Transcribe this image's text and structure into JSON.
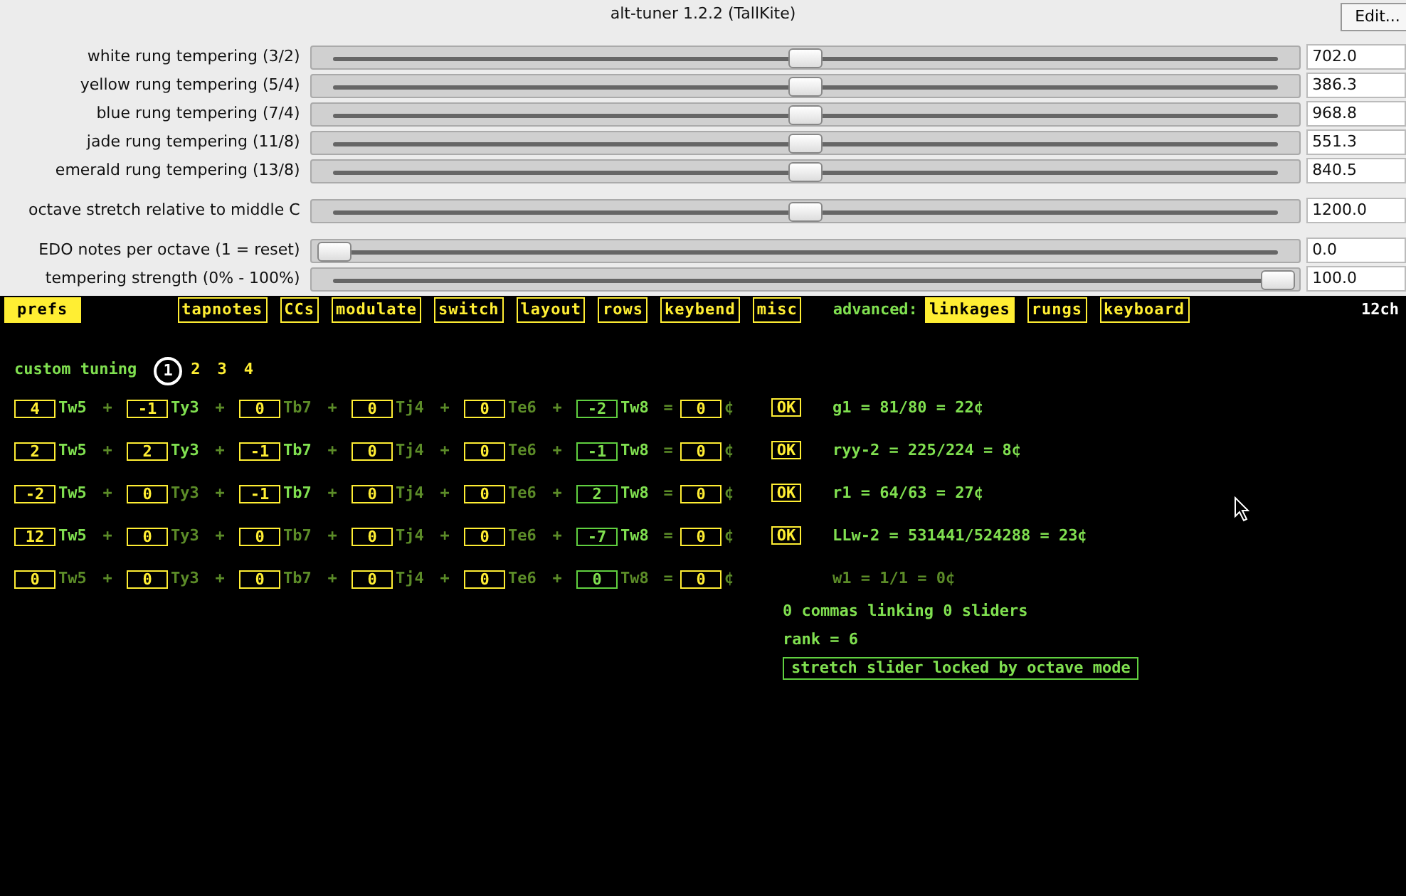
{
  "window": {
    "title": "alt-tuner 1.2.2 (TallKite)",
    "edit_button": "Edit..."
  },
  "slider_groups": [
    [
      {
        "label": "white rung tempering (3/2)",
        "level": 0.5,
        "reading": "702.0"
      },
      {
        "label": "yellow rung tempering (5/4)",
        "level": 0.5,
        "reading": "386.3"
      },
      {
        "label": "blue rung tempering (7/4)",
        "level": 0.5,
        "reading": "968.8"
      },
      {
        "label": "jade rung tempering (11/8)",
        "level": 0.5,
        "reading": "551.3"
      },
      {
        "label": "emerald rung tempering (13/8)",
        "level": 0.5,
        "reading": "840.5"
      }
    ],
    [
      {
        "label": "octave stretch relative to middle C",
        "level": 0.5,
        "reading": "1200.0"
      }
    ],
    [
      {
        "label": "EDO notes per octave (1 = reset)",
        "level": 0,
        "reading": "0.0"
      },
      {
        "label": "tempering strength (0% - 100%)",
        "level": 1,
        "reading": "100.0"
      }
    ]
  ],
  "tabs": [
    {
      "label": "prefs",
      "selected": true
    },
    {
      "label": "tapnotes",
      "selected": false
    },
    {
      "label": "CCs",
      "selected": false
    },
    {
      "label": "modulate",
      "selected": false
    },
    {
      "label": "switch",
      "selected": false
    },
    {
      "label": "layout",
      "selected": false
    },
    {
      "label": "rows",
      "selected": false
    },
    {
      "label": "keybend",
      "selected": false
    },
    {
      "label": "misc",
      "selected": false
    }
  ],
  "advanced_label": "advanced:",
  "advanced_tabs": [
    {
      "label": "linkages",
      "selected": true
    },
    {
      "label": "rungs",
      "selected": false
    },
    {
      "label": "keyboard",
      "selected": false
    }
  ],
  "channels": "12ch",
  "tuning": {
    "label": "custom tuning",
    "options": [
      {
        "label": "1",
        "selected": true
      },
      {
        "label": "2",
        "selected": false
      },
      {
        "label": "3",
        "selected": false
      },
      {
        "label": "4",
        "selected": false
      }
    ]
  },
  "equations": [
    {
      "terms": [
        {
          "value": "4",
          "name": "Tw5",
          "active": true,
          "kind": "rung"
        },
        {
          "op": "+",
          "value": "-1",
          "name": "Ty3",
          "active": true,
          "kind": "rung"
        },
        {
          "op": "+",
          "value": "0",
          "name": "Tb7",
          "active": false,
          "kind": "rung"
        },
        {
          "op": "+",
          "value": "0",
          "name": "Tj4",
          "active": false,
          "kind": "rung"
        },
        {
          "op": "+",
          "value": "0",
          "name": "Te6",
          "active": false,
          "kind": "rung"
        },
        {
          "op": "+",
          "value": "-2",
          "name": "Tw8",
          "active": true,
          "kind": "octave"
        }
      ],
      "equals": "=",
      "total": "0",
      "unit": "¢",
      "ok": "OK",
      "comma": "g1 = 81/80 = 22¢",
      "active": true
    },
    {
      "terms": [
        {
          "value": "2",
          "name": "Tw5",
          "active": true,
          "kind": "rung"
        },
        {
          "op": "+",
          "value": "2",
          "name": "Ty3",
          "active": true,
          "kind": "rung"
        },
        {
          "op": "+",
          "value": "-1",
          "name": "Tb7",
          "active": true,
          "kind": "rung"
        },
        {
          "op": "+",
          "value": "0",
          "name": "Tj4",
          "active": false,
          "kind": "rung"
        },
        {
          "op": "+",
          "value": "0",
          "name": "Te6",
          "active": false,
          "kind": "rung"
        },
        {
          "op": "+",
          "value": "-1",
          "name": "Tw8",
          "active": true,
          "kind": "octave"
        }
      ],
      "equals": "=",
      "total": "0",
      "unit": "¢",
      "ok": "OK",
      "comma": "ryy-2 = 225/224 = 8¢",
      "active": true
    },
    {
      "terms": [
        {
          "value": "-2",
          "name": "Tw5",
          "active": true,
          "kind": "rung"
        },
        {
          "op": "+",
          "value": "0",
          "name": "Ty3",
          "active": false,
          "kind": "rung"
        },
        {
          "op": "+",
          "value": "-1",
          "name": "Tb7",
          "active": true,
          "kind": "rung"
        },
        {
          "op": "+",
          "value": "0",
          "name": "Tj4",
          "active": false,
          "kind": "rung"
        },
        {
          "op": "+",
          "value": "0",
          "name": "Te6",
          "active": false,
          "kind": "rung"
        },
        {
          "op": "+",
          "value": "2",
          "name": "Tw8",
          "active": true,
          "kind": "octave"
        }
      ],
      "equals": "=",
      "total": "0",
      "unit": "¢",
      "ok": "OK",
      "comma": "r1 = 64/63 = 27¢",
      "active": true
    },
    {
      "terms": [
        {
          "value": "12",
          "name": "Tw5",
          "active": true,
          "kind": "rung"
        },
        {
          "op": "+",
          "value": "0",
          "name": "Ty3",
          "active": false,
          "kind": "rung"
        },
        {
          "op": "+",
          "value": "0",
          "name": "Tb7",
          "active": false,
          "kind": "rung"
        },
        {
          "op": "+",
          "value": "0",
          "name": "Tj4",
          "active": false,
          "kind": "rung"
        },
        {
          "op": "+",
          "value": "0",
          "name": "Te6",
          "active": false,
          "kind": "rung"
        },
        {
          "op": "+",
          "value": "-7",
          "name": "Tw8",
          "active": true,
          "kind": "octave"
        }
      ],
      "equals": "=",
      "total": "0",
      "unit": "¢",
      "ok": "OK",
      "comma": "LLw-2 = 531441/524288 = 23¢",
      "active": true
    },
    {
      "terms": [
        {
          "value": "0",
          "name": "Tw5",
          "active": false,
          "kind": "rung"
        },
        {
          "op": "+",
          "value": "0",
          "name": "Ty3",
          "active": false,
          "kind": "rung"
        },
        {
          "op": "+",
          "value": "0",
          "name": "Tb7",
          "active": false,
          "kind": "rung"
        },
        {
          "op": "+",
          "value": "0",
          "name": "Tj4",
          "active": false,
          "kind": "rung"
        },
        {
          "op": "+",
          "value": "0",
          "name": "Te6",
          "active": false,
          "kind": "rung"
        },
        {
          "op": "+",
          "value": "0",
          "name": "Tw8",
          "active": false,
          "kind": "octave"
        }
      ],
      "equals": "=",
      "total": "0",
      "unit": "¢",
      "comma": "w1 = 1/1 = 0¢",
      "active": false
    }
  ],
  "summary": [
    "0 commas linking 0 sliders",
    "rank = 6"
  ],
  "notice": "stretch slider locked by octave mode"
}
